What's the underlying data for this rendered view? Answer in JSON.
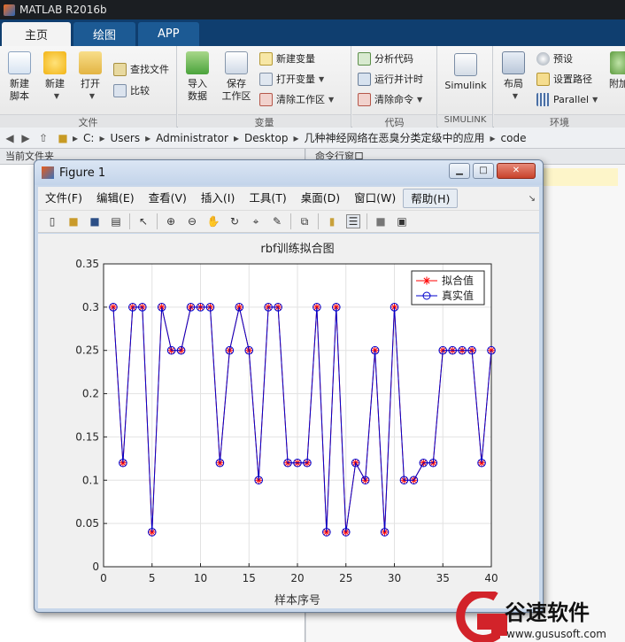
{
  "app": {
    "title": "MATLAB R2016b"
  },
  "ribbon_tabs": [
    {
      "label": "主页",
      "active": true
    },
    {
      "label": "绘图",
      "active": false
    },
    {
      "label": "APP",
      "active": false
    }
  ],
  "ribbon": {
    "file_group": {
      "label": "文件",
      "new_script": "新建\n脚本",
      "new": "新建",
      "open": "打开",
      "find_files": "查找文件",
      "compare": "比较"
    },
    "variable_group": {
      "label": "变量",
      "import": "导入\n数据",
      "save_workspace": "保存\n工作区",
      "new_variable": "新建变量",
      "open_variable": "打开变量",
      "clear_workspace": "清除工作区"
    },
    "code_group": {
      "label": "代码",
      "analyze": "分析代码",
      "run_and_time": "运行并计时",
      "clear_commands": "清除命令"
    },
    "simulink_group": {
      "label": "SIMULINK",
      "simulink": "Simulink"
    },
    "env_group": {
      "label": "环境",
      "layout": "布局",
      "preferences": "预设",
      "set_path": "设置路径",
      "parallel": "Parallel",
      "addons": "附加"
    }
  },
  "address": {
    "crumbs": [
      "C:",
      "Users",
      "Administrator",
      "Desktop",
      "几种神经网络在恶臭分类定级中的应用",
      "code"
    ]
  },
  "panels": {
    "current_folder": "当前文件夹",
    "command_window": "命令行窗口"
  },
  "figure": {
    "title": "Figure 1",
    "menus": [
      "文件(F)",
      "编辑(E)",
      "查看(V)",
      "插入(I)",
      "工具(T)",
      "桌面(D)",
      "窗口(W)",
      "帮助(H)"
    ],
    "colors": {
      "fit": "#ff0000",
      "true": "#0000cc"
    }
  },
  "chart_data": {
    "type": "line",
    "title": "rbf训练拟合图",
    "xlabel": "样本序号",
    "ylabel": "",
    "xlim": [
      0,
      40
    ],
    "ylim": [
      0,
      0.35
    ],
    "xticks": [
      0,
      5,
      10,
      15,
      20,
      25,
      30,
      35,
      40
    ],
    "yticks": [
      0,
      0.05,
      0.1,
      0.15,
      0.2,
      0.25,
      0.3,
      0.35
    ],
    "grid": true,
    "legend_position": "top-right",
    "x": [
      1,
      2,
      3,
      4,
      5,
      6,
      7,
      8,
      9,
      10,
      11,
      12,
      13,
      14,
      15,
      16,
      17,
      18,
      19,
      20,
      21,
      22,
      23,
      24,
      25,
      26,
      27,
      28,
      29,
      30,
      31,
      32,
      33,
      34,
      35,
      36,
      37,
      38,
      39,
      40
    ],
    "series": [
      {
        "name": "拟合值",
        "marker": "*",
        "color": "#ff0000",
        "values": [
          0.3,
          0.12,
          0.3,
          0.3,
          0.04,
          0.3,
          0.25,
          0.25,
          0.3,
          0.3,
          0.3,
          0.12,
          0.25,
          0.3,
          0.25,
          0.1,
          0.3,
          0.3,
          0.12,
          0.12,
          0.12,
          0.3,
          0.04,
          0.3,
          0.04,
          0.12,
          0.1,
          0.25,
          0.04,
          0.3,
          0.1,
          0.1,
          0.12,
          0.12,
          0.25,
          0.25,
          0.25,
          0.25,
          0.12,
          0.25
        ]
      },
      {
        "name": "真实值",
        "marker": "o",
        "color": "#0000cc",
        "values": [
          0.3,
          0.12,
          0.3,
          0.3,
          0.04,
          0.3,
          0.25,
          0.25,
          0.3,
          0.3,
          0.3,
          0.12,
          0.25,
          0.3,
          0.25,
          0.1,
          0.3,
          0.3,
          0.12,
          0.12,
          0.12,
          0.3,
          0.04,
          0.3,
          0.04,
          0.12,
          0.1,
          0.25,
          0.04,
          0.3,
          0.1,
          0.1,
          0.12,
          0.12,
          0.25,
          0.25,
          0.25,
          0.25,
          0.12,
          0.25
        ]
      }
    ]
  },
  "watermark": {
    "brand": "谷速软件",
    "url": "www.gususoft.com"
  }
}
